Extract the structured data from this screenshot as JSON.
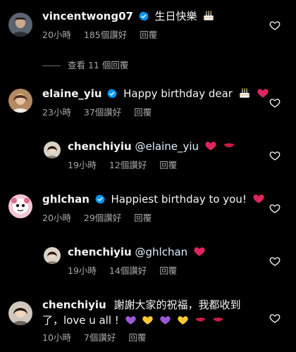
{
  "comments": [
    {
      "username": "vincentwong07",
      "text": "生日快樂",
      "time": "20小時",
      "likes": "185個讚好",
      "reply": "回覆",
      "view_replies": "查看 11 個回覆"
    },
    {
      "username": "elaine_yiu",
      "text": "Happy birthday dear",
      "time": "23小時",
      "likes": "37個讚好",
      "reply": "回覆"
    },
    {
      "username": "chenchiyiu",
      "mention": "@elaine_yiu",
      "time": "19小時",
      "likes": "12個讚好",
      "reply": "回覆"
    },
    {
      "username": "ghlchan",
      "text": "Happiest birthday to you!",
      "time": "20小時",
      "likes": "29個讚好",
      "reply": "回覆"
    },
    {
      "username": "chenchiyiu",
      "mention": "@ghlchan",
      "time": "19小時",
      "likes": "14個讚好",
      "reply": "回覆"
    },
    {
      "username": "chenchiyiu",
      "text_line1": "謝謝大家的祝福，我都收到",
      "text_line2": "了，love u all !",
      "time": "10小時",
      "likes": "7個讚好",
      "reply": "回覆"
    }
  ],
  "icons": {
    "verified": "verified-badge-icon",
    "like": "heart-outline-icon",
    "cake": "birthday-cake-emoji",
    "red_heart": "red-heart-emoji",
    "kiss": "kiss-mark-emoji",
    "purple_heart": "purple-heart-emoji",
    "yellow_heart": "yellow-heart-emoji"
  },
  "colors": {
    "background": "#000000",
    "text": "#f5f5f5",
    "meta": "#a8a8a8",
    "verified": "#0095f6",
    "red_heart": "#e0245e",
    "purple_heart": "#9b59d6",
    "yellow_heart": "#ffcc33"
  }
}
